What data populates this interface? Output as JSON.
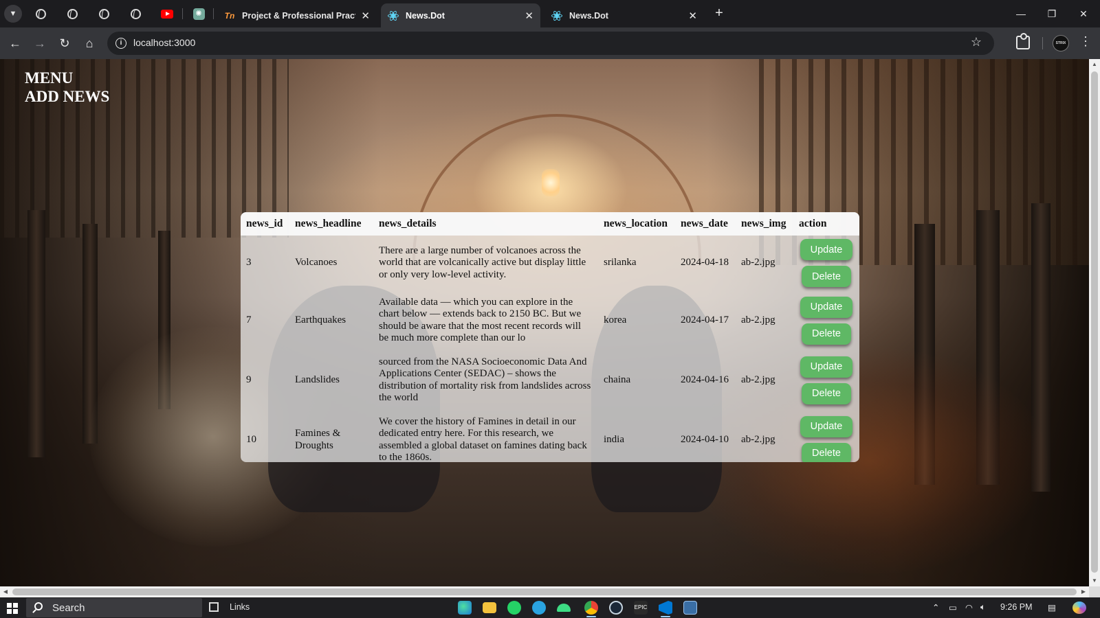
{
  "browser": {
    "tabs": [
      {
        "title": "Project & Professional Practice",
        "favicon": "tn-icon",
        "active": false
      },
      {
        "title": "News.Dot",
        "favicon": "react-icon",
        "active": true
      },
      {
        "title": "News.Dot",
        "favicon": "react-icon",
        "active": false
      }
    ],
    "pinned_tabs": [
      "globe-icon",
      "globe-icon",
      "globe-icon",
      "globe-icon",
      "youtube-icon",
      "chatgpt-icon"
    ],
    "address": "localhost:3000"
  },
  "page": {
    "menu_label": "MENU",
    "add_news_label": "ADD NEWS",
    "table": {
      "columns": [
        "news_id",
        "news_headline",
        "news_details",
        "news_location",
        "news_date",
        "news_img",
        "action"
      ],
      "rows": [
        {
          "id": "3",
          "headline": "Volcanoes",
          "details": "There are a large number of volcanoes across the world that are volcanically active but display little or only very low-level activity.",
          "location": "srilanka",
          "date": "2024-04-18",
          "img": "ab-2.jpg"
        },
        {
          "id": "7",
          "headline": "Earthquakes",
          "details": "Available data — which you can explore in the chart below — extends back to 2150 BC. But we should be aware that the most recent records will be much more complete than our lo",
          "location": "korea",
          "date": "2024-04-17",
          "img": "ab-2.jpg"
        },
        {
          "id": "9",
          "headline": "Landslides",
          "details": "sourced from the NASA Socioeconomic Data And Applications Center (SEDAC) – shows the distribution of mortality risk from landslides across the world",
          "location": "chaina",
          "date": "2024-04-16",
          "img": "ab-2.jpg"
        },
        {
          "id": "10",
          "headline": "Famines & Droughts",
          "details": "We cover the history of Famines in detail in our dedicated entry here. For this research, we assembled a global dataset on famines dating back to the 1860s.",
          "location": "india",
          "date": "2024-04-10",
          "img": "ab-2.jpg"
        }
      ],
      "update_label": "Update",
      "delete_label": "Delete"
    },
    "colors": {
      "button": "#5fb865",
      "menu_text": "#ffffff"
    }
  },
  "taskbar": {
    "search_label": "Search",
    "links_label": "Links",
    "time": "9:26 PM",
    "apps": [
      "edge-icon",
      "file-explorer-icon",
      "whatsapp-icon",
      "telegram-icon",
      "android-studio-icon",
      "chrome-icon",
      "steam-icon",
      "epic-games-icon",
      "vscode-icon",
      "app-icon"
    ]
  }
}
